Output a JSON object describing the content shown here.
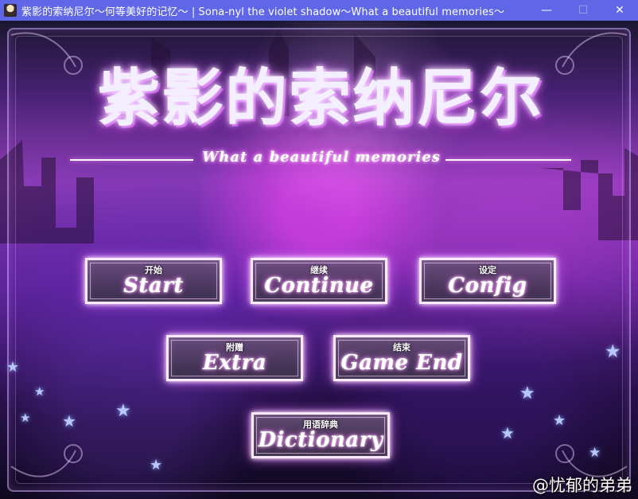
{
  "window": {
    "title": "紫影的索纳尼尔～何等美好的记忆～ | Sona-nyl the violet shadow～What a beautiful memories～",
    "controls": {
      "minimize": "—",
      "maximize": "☐",
      "close": "✕"
    }
  },
  "logo": {
    "title": "紫影的索纳尼尔",
    "subtitle": "What a beautiful memories"
  },
  "menu": {
    "start": {
      "cn": "开始",
      "en": "Start"
    },
    "continue": {
      "cn": "继续",
      "en": "Continue"
    },
    "config": {
      "cn": "设定",
      "en": "Config"
    },
    "extra": {
      "cn": "附赠",
      "en": "Extra"
    },
    "game_end": {
      "cn": "结束",
      "en": "Game End"
    },
    "dictionary": {
      "cn": "用语辞典",
      "en": "Dictionary"
    }
  },
  "watermark": "@忧郁的弟弟",
  "icons": {
    "app": "app-icon",
    "star": "star-icon"
  },
  "colors": {
    "titlebar": "#5f67e6",
    "accent": "#ff6dff",
    "text": "#ffffff"
  }
}
